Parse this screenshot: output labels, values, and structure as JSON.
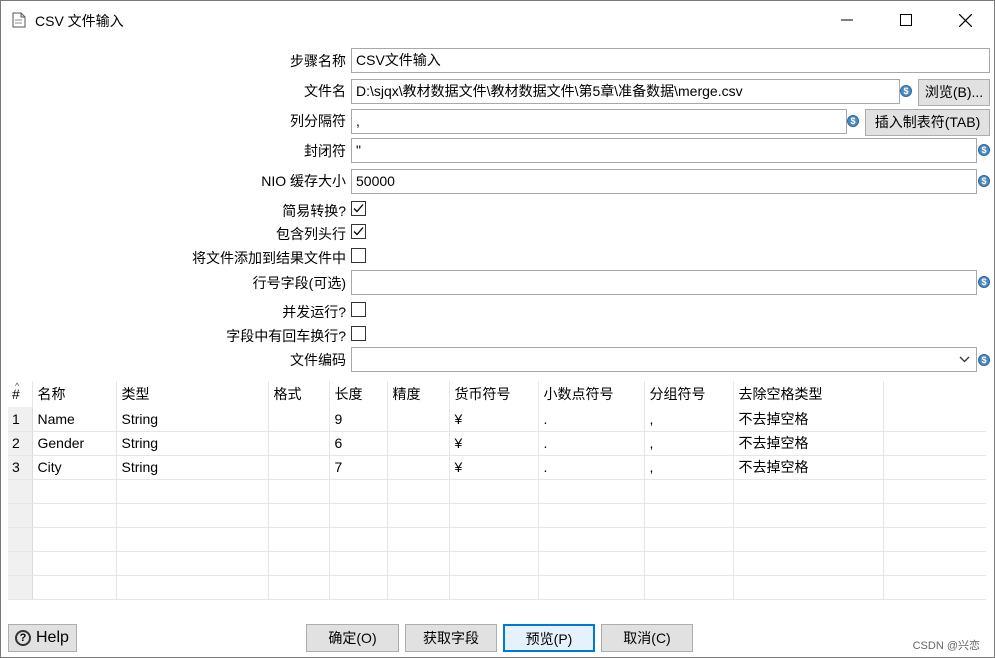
{
  "window": {
    "title": "CSV 文件输入"
  },
  "form": {
    "step_name_label": "步骤名称",
    "step_name_value": "CSV文件输入",
    "filename_label": "文件名",
    "filename_value": "D:\\sjqx\\教材数据文件\\教材数据文件\\第5章\\准备数据\\merge.csv",
    "browse_button": "浏览(B)...",
    "delimiter_label": "列分隔符",
    "delimiter_value": ",",
    "insert_tab_button": "插入制表符(TAB)",
    "enclosure_label": "封闭符",
    "enclosure_value": "\"",
    "nio_buffer_label": "NIO 缓存大小",
    "nio_buffer_value": "50000",
    "lazy_conversion_label": "简易转换?",
    "lazy_conversion_checked": true,
    "header_row_label": "包含列头行",
    "header_row_checked": true,
    "add_filename_label": "将文件添加到结果文件中",
    "add_filename_checked": false,
    "row_number_field_label": "行号字段(可选)",
    "row_number_field_value": "",
    "parallel_label": "并发运行?",
    "parallel_checked": false,
    "newline_in_field_label": "字段中有回车换行?",
    "newline_in_field_checked": false,
    "encoding_label": "文件编码",
    "encoding_value": ""
  },
  "table": {
    "columns": [
      "#",
      "名称",
      "类型",
      "格式",
      "长度",
      "精度",
      "货币符号",
      "小数点符号",
      "分组符号",
      "去除空格类型"
    ],
    "rows": [
      [
        "1",
        "Name",
        "String",
        "",
        "9",
        "",
        "¥",
        ".",
        ",",
        "不去掉空格"
      ],
      [
        "2",
        "Gender",
        "String",
        "",
        "6",
        "",
        "¥",
        ".",
        ",",
        "不去掉空格"
      ],
      [
        "3",
        "City",
        "String",
        "",
        "7",
        "",
        "¥",
        ".",
        ",",
        "不去掉空格"
      ],
      [
        "",
        "",
        "",
        "",
        "",
        "",
        "",
        "",
        "",
        ""
      ],
      [
        "",
        "",
        "",
        "",
        "",
        "",
        "",
        "",
        "",
        ""
      ],
      [
        "",
        "",
        "",
        "",
        "",
        "",
        "",
        "",
        "",
        ""
      ],
      [
        "",
        "",
        "",
        "",
        "",
        "",
        "",
        "",
        "",
        ""
      ],
      [
        "",
        "",
        "",
        "",
        "",
        "",
        "",
        "",
        "",
        ""
      ]
    ]
  },
  "buttons": {
    "help": "Help",
    "ok": "确定(O)",
    "get_fields": "获取字段",
    "preview": "预览(P)",
    "cancel": "取消(C)"
  },
  "watermark": "CSDN @兴恋",
  "colors": {
    "variable_icon": "#4a8bc4",
    "button_face": "#e1e1e1",
    "focus_border": "#0078d7"
  }
}
